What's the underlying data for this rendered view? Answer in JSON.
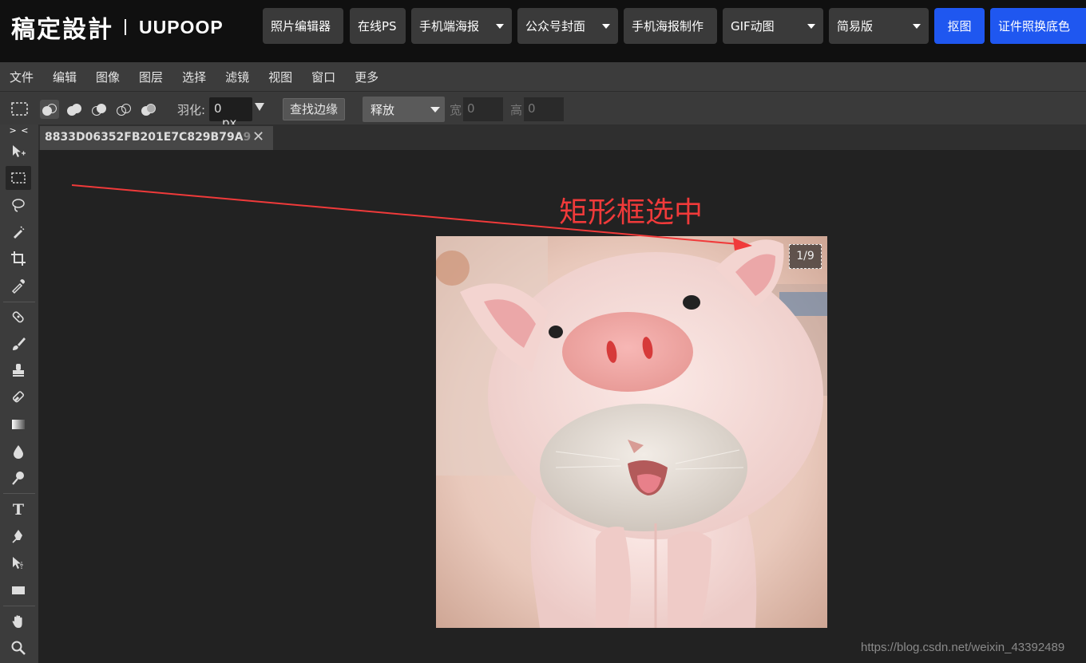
{
  "brand": {
    "name_cn": "稿定設計",
    "name_en": "UUPOOP"
  },
  "top_nav": [
    {
      "label": "照片编辑器",
      "dropdown": false
    },
    {
      "label": "在线PS",
      "dropdown": false
    },
    {
      "label": "手机端海报",
      "dropdown": true
    },
    {
      "label": "公众号封面",
      "dropdown": true
    },
    {
      "label": "手机海报制作",
      "dropdown": false
    },
    {
      "label": "GIF动图",
      "dropdown": true
    },
    {
      "label": "简易版",
      "dropdown": true
    },
    {
      "label": "抠图",
      "dropdown": false
    },
    {
      "label": "证件照换底色",
      "dropdown": false
    }
  ],
  "menu": [
    "文件",
    "编辑",
    "图像",
    "图层",
    "选择",
    "滤镜",
    "视图",
    "窗口",
    "更多"
  ],
  "options": {
    "feather_label": "羽化:",
    "feather_value": "0",
    "feather_unit": "px",
    "find_edge": "查找边缘",
    "style_select": "释放",
    "width_label": "宽",
    "width_value": "0",
    "height_label": "高",
    "height_value": "0"
  },
  "tool_panel": {
    "collapse": "> <"
  },
  "document": {
    "tab_title": "8833D06352FB201E7C829B79A",
    "tab_title_fade": "9",
    "close": "✕"
  },
  "canvas": {
    "page_indicator": "1/9",
    "annotation": "矩形框选中"
  },
  "watermark": "https://blog.csdn.net/weixin_43392489",
  "colors": {
    "accent_blue": "#1f57f0",
    "annotation_red": "#f03a3a",
    "topbar": "#101010"
  }
}
